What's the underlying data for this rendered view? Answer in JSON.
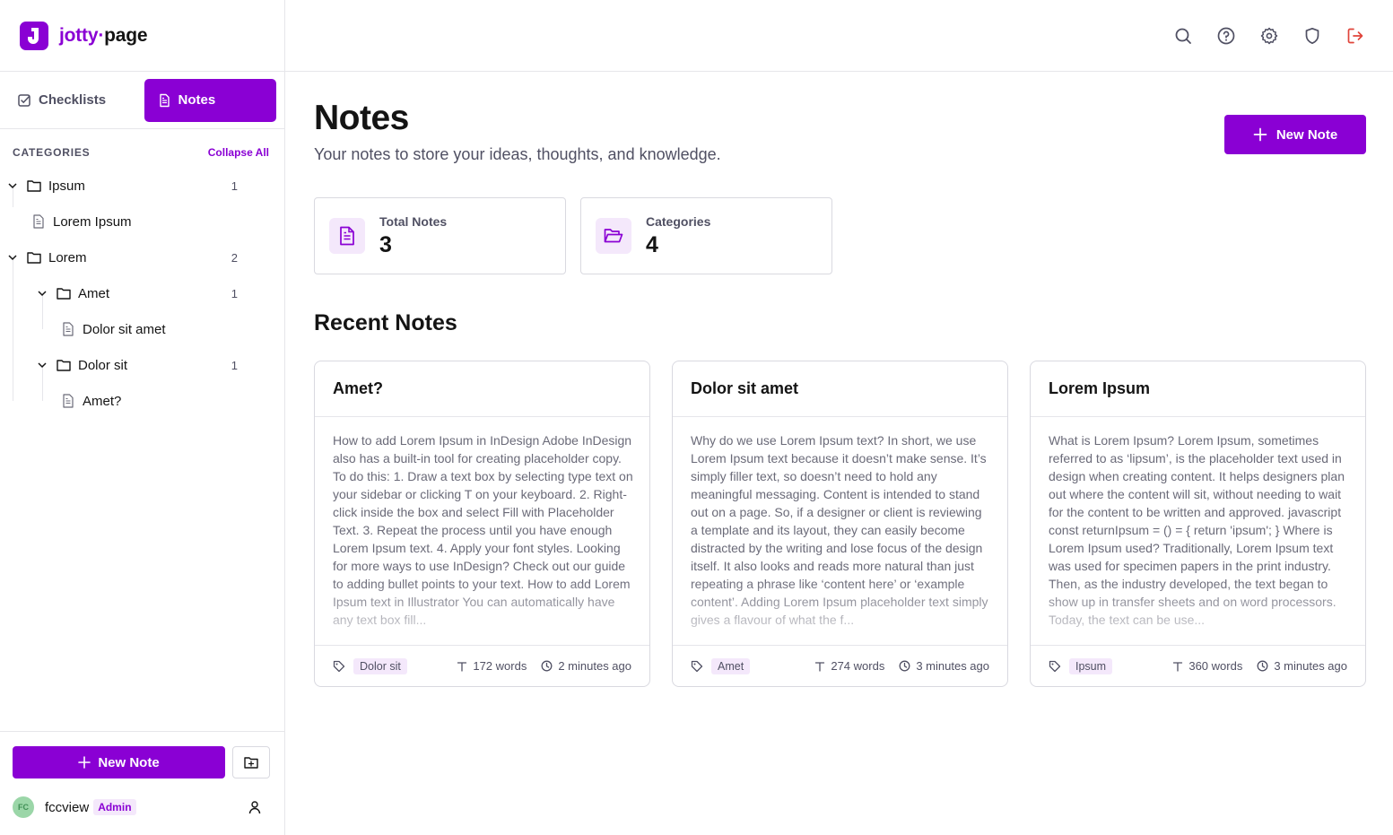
{
  "brand": {
    "name_accent": "jotty",
    "name_sep": "·",
    "name_rest": "page",
    "logo_letter": "J",
    "accent_color": "#8a00d4"
  },
  "mode_tabs": [
    {
      "label": "Checklists",
      "icon": "checkbox-icon",
      "active": false
    },
    {
      "label": "Notes",
      "icon": "note-icon",
      "active": true
    }
  ],
  "categories": {
    "title": "CATEGORIES",
    "collapse_label": "Collapse All",
    "tree": [
      {
        "type": "folder",
        "label": "Ipsum",
        "count": "1",
        "depth": 0
      },
      {
        "type": "note",
        "label": "Lorem Ipsum",
        "depth": 1
      },
      {
        "type": "folder",
        "label": "Lorem",
        "count": "2",
        "depth": 0
      },
      {
        "type": "folder",
        "label": "Amet",
        "count": "1",
        "depth": 1
      },
      {
        "type": "note",
        "label": "Dolor sit amet",
        "depth": 2
      },
      {
        "type": "folder",
        "label": "Dolor sit",
        "count": "1",
        "depth": 1
      },
      {
        "type": "note",
        "label": "Amet?",
        "depth": 2
      }
    ]
  },
  "sidebar_bottom": {
    "new_note_label": "New Note",
    "user": {
      "initials": "FC",
      "name": "fccview",
      "role": "Admin"
    }
  },
  "header": {
    "icons": [
      "search-icon",
      "help-icon",
      "gear-icon",
      "shield-icon",
      "logout-icon"
    ]
  },
  "main": {
    "title": "Notes",
    "subtitle": "Your notes to store your ideas, thoughts, and knowledge.",
    "new_note_label": "New Note",
    "stats": [
      {
        "label": "Total Notes",
        "value": "3",
        "icon": "note-icon"
      },
      {
        "label": "Categories",
        "value": "4",
        "icon": "folder-open-icon"
      }
    ],
    "recent_title": "Recent Notes",
    "cards": [
      {
        "title": "Amet?",
        "body": "How to add Lorem Ipsum in InDesign Adobe InDesign also has a built-in tool for creating placeholder copy. To do this: 1. Draw a text box by selecting type text on your sidebar or clicking T on your keyboard. 2. Right-click inside the box and select Fill with Placeholder Text. 3. Repeat the process until you have enough Lorem Ipsum text. 4. Apply your font styles. Looking for more ways to use InDesign? Check out our guide to adding bullet points to your text. How to add Lorem Ipsum text in Illustrator You can automatically have any text box fill...",
        "tag": "Dolor sit",
        "words": "172 words",
        "time": "2 minutes ago"
      },
      {
        "title": "Dolor sit amet",
        "body": "Why do we use Lorem Ipsum text? In short, we use Lorem Ipsum text because it doesn’t make sense. It’s simply filler text, so doesn’t need to hold any meaningful messaging. Content is intended to stand out on a page. So, if a designer or client is reviewing a template and its layout, they can easily become distracted by the writing and lose focus of the design itself. It also looks and reads more natural than just repeating a phrase like ‘content here’ or ‘example content’. Adding Lorem Ipsum placeholder text simply gives a flavour of what the f...",
        "tag": "Amet",
        "words": "274 words",
        "time": "3 minutes ago"
      },
      {
        "title": "Lorem Ipsum",
        "body": "What is Lorem Ipsum? Lorem Ipsum, sometimes referred to as ‘lipsum’, is the placeholder text used in design when creating content. It helps designers plan out where the content will sit, without needing to wait for the content to be written and approved. javascript const returnIpsum = () = { return 'ipsum'; } Where is Lorem Ipsum used? Traditionally, Lorem Ipsum text was used for specimen papers in the print industry. Then, as the industry developed, the text began to show up in transfer sheets and on word processors. Today, the text can be use...",
        "tag": "Ipsum",
        "words": "360 words",
        "time": "3 minutes ago"
      }
    ]
  }
}
